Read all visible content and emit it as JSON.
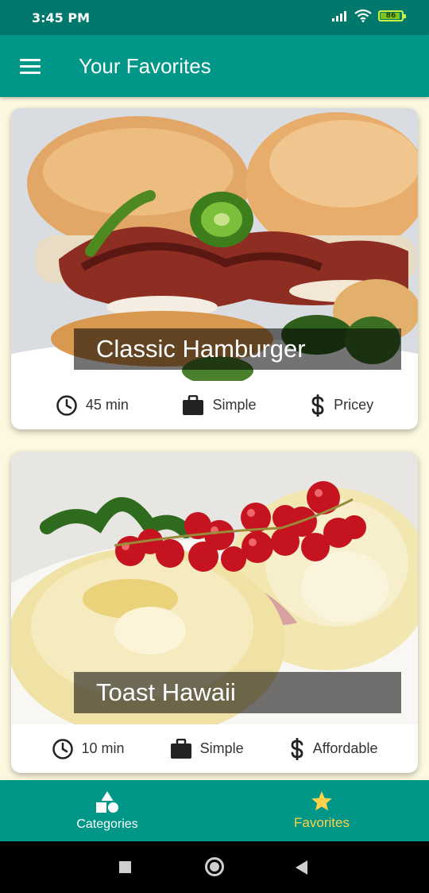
{
  "status_bar": {
    "time": "3:45 PM",
    "battery_level": "86",
    "battery_fraction": 0.86,
    "icons": [
      "signal-icon",
      "wifi-icon",
      "battery-icon"
    ]
  },
  "app_bar": {
    "title": "Your Favorites",
    "menu_icon": "hamburger-menu-icon"
  },
  "meals": [
    {
      "title": "Classic Hamburger",
      "image": "hamburger-photo",
      "duration": "45 min",
      "complexity": "Simple",
      "affordability": "Pricey"
    },
    {
      "title": "Toast Hawaii",
      "image": "toast-hawaii-photo",
      "duration": "10 min",
      "complexity": "Simple",
      "affordability": "Affordable"
    }
  ],
  "bottom_nav": {
    "tabs": [
      {
        "label": "Categories",
        "icon": "shapes-icon",
        "active": false
      },
      {
        "label": "Favorites",
        "icon": "star-icon",
        "active": true
      }
    ],
    "active_color": "#ffd24a"
  },
  "colors": {
    "primary": "#009688",
    "status_bar": "#00786c",
    "background": "#fdf8e0",
    "accent": "#ffd24a"
  },
  "system_nav": {
    "icons": [
      "recents-icon",
      "home-icon",
      "back-icon"
    ]
  }
}
